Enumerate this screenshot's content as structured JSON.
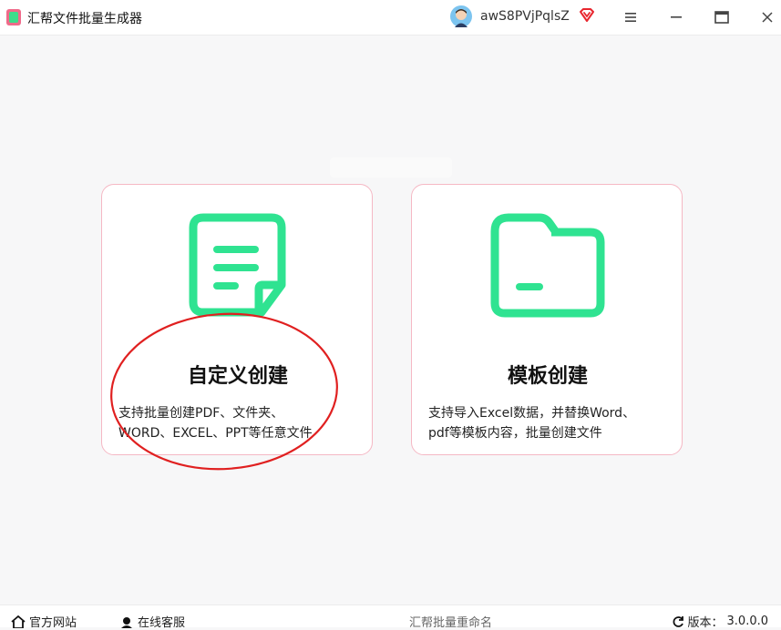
{
  "titlebar": {
    "app_title": "汇帮文件批量生成器",
    "username": "awS8PVjPqlsZ",
    "icons": [
      "app-logo-icon",
      "avatar-icon",
      "vip-diamond-icon",
      "menu-icon",
      "minimize-icon",
      "maximize-icon",
      "close-icon"
    ]
  },
  "cards": [
    {
      "title": "自定义创建",
      "desc_line1": "支持批量创建PDF、文件夹、",
      "desc_line2": "WORD、EXCEL、PPT等任意文件",
      "icon": "document-icon"
    },
    {
      "title": "模板创建",
      "desc_line1": "支持导入Excel数据，并替换Word、",
      "desc_line2": "pdf等模板内容，批量创建文件",
      "icon": "folder-icon"
    }
  ],
  "footer": {
    "website_label": "官方网站",
    "support_label": "在线客服",
    "center_label": "汇帮批量重命名",
    "version_label": "版本：",
    "version_value": "3.0.0.0"
  },
  "colors": {
    "accent_green": "#2fe391",
    "card_border": "#f5b8c4",
    "annotation_red": "#e02020",
    "vip_red": "#e8262e"
  }
}
